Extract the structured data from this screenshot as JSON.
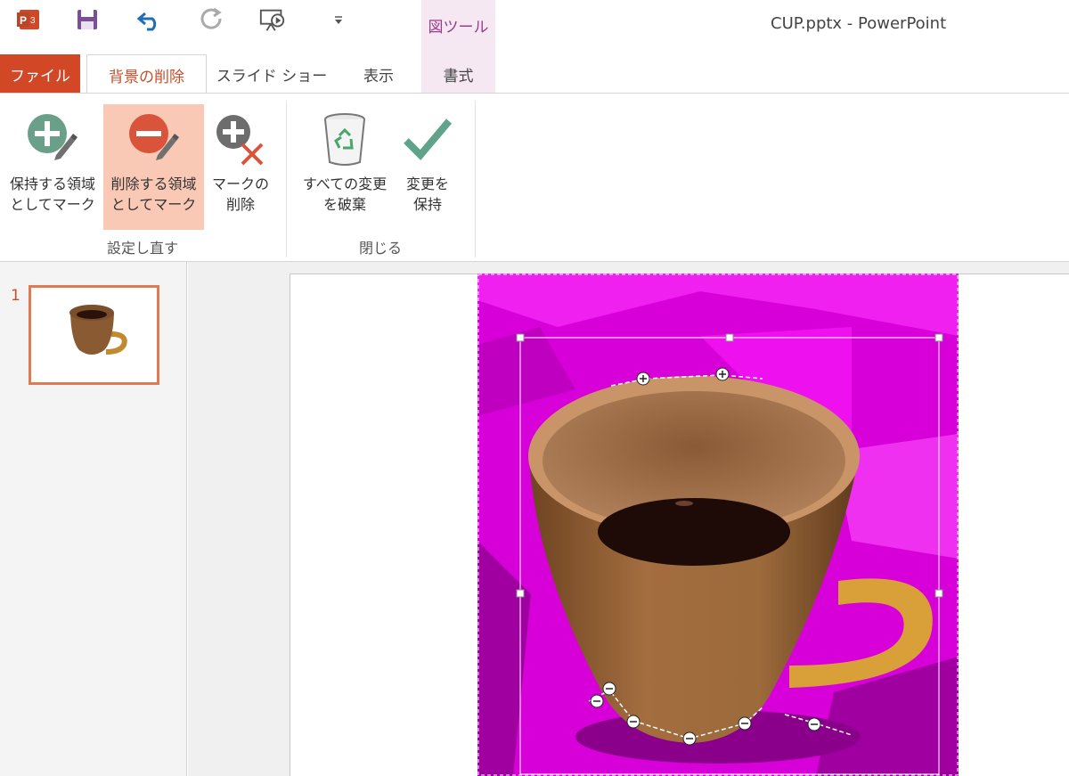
{
  "window": {
    "title": "CUP.pptx - PowerPoint"
  },
  "quick_access": [
    {
      "name": "powerpoint-logo-icon"
    },
    {
      "name": "save-icon"
    },
    {
      "name": "undo-icon"
    },
    {
      "name": "redo-icon"
    },
    {
      "name": "start-slideshow-icon"
    },
    {
      "name": "customize-toolbar-icon"
    }
  ],
  "context_tab_group": {
    "label": "図ツール"
  },
  "tabs": [
    {
      "label": "ファイル"
    },
    {
      "label": "背景の削除"
    },
    {
      "label": "スライド ショー"
    },
    {
      "label": "表示"
    },
    {
      "label": "書式"
    }
  ],
  "ribbon": {
    "groups": [
      {
        "label": "設定し直す",
        "buttons": [
          {
            "label": "保持する領域\nとしてマーク",
            "icon": "mark-keep-icon"
          },
          {
            "label": "削除する領域\nとしてマーク",
            "icon": "mark-remove-icon",
            "selected": true
          },
          {
            "label": "マークの\n削除",
            "icon": "delete-mark-icon"
          }
        ]
      },
      {
        "label": "閉じる",
        "buttons": [
          {
            "label": "すべての変更\nを破棄",
            "icon": "recycle-bin-icon"
          },
          {
            "label": "変更を\n保持",
            "icon": "checkmark-icon"
          }
        ]
      }
    ]
  },
  "slides_pane": {
    "slides": [
      {
        "number": "1"
      }
    ]
  },
  "colors": {
    "accent": "#d24726",
    "removal_overlay": "#e600e6",
    "selected_button": "#f9c9b5"
  }
}
